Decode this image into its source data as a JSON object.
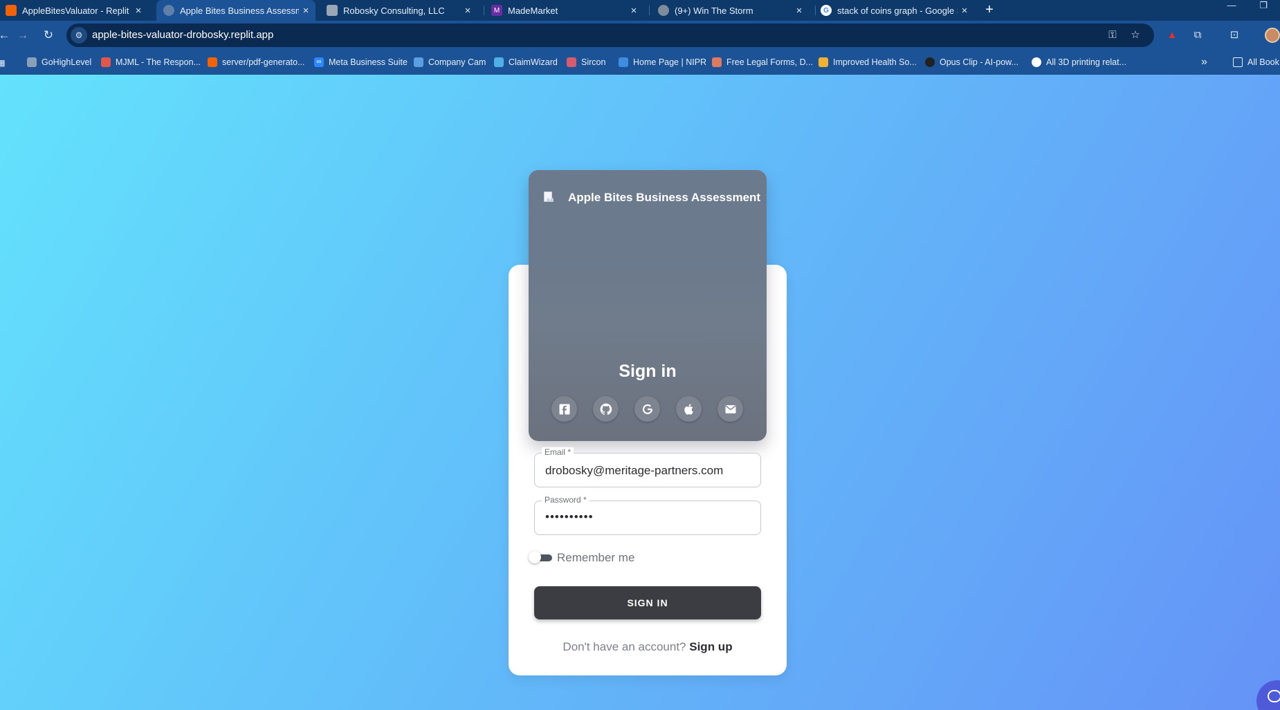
{
  "tabs": [
    {
      "title": "AppleBitesValuator - Replit",
      "icon": "replit-icon",
      "color": "#f26207"
    },
    {
      "title": "Apple Bites Business Assessmen",
      "icon": "globe-icon",
      "color": "#8aa4c4"
    },
    {
      "title": "Robosky Consulting, LLC",
      "icon": "company-icon",
      "color": "#9aa7b7"
    },
    {
      "title": "MadeMarket",
      "icon": "mademarket-icon",
      "color": "#6a2ca3"
    },
    {
      "title": "(9+) Win The Storm",
      "icon": "storm-icon",
      "color": "#7f8c9c"
    },
    {
      "title": "stack of coins graph - Google S",
      "icon": "google-icon",
      "color": "#ffffff"
    }
  ],
  "window": {
    "minimize": "—",
    "maximize": "❐"
  },
  "address_bar": {
    "url": "apple-bites-valuator-drobosky.replit.app"
  },
  "bookmarks": [
    {
      "label": "GoHighLevel",
      "icon": "gohighlevel-icon",
      "color": "#8aa0b8"
    },
    {
      "label": "MJML - The Respon...",
      "icon": "mjml-icon",
      "color": "#e2574c"
    },
    {
      "label": "server/pdf-generato...",
      "icon": "replit-icon",
      "color": "#f26207"
    },
    {
      "label": "Meta Business Suite",
      "icon": "meta-icon",
      "color": "#2d88ff"
    },
    {
      "label": "Company Cam",
      "icon": "companycam-icon",
      "color": "#5aa0e0"
    },
    {
      "label": "ClaimWizard",
      "icon": "claimwizard-icon",
      "color": "#4fb0e8"
    },
    {
      "label": "Sircon",
      "icon": "sircon-icon",
      "color": "#d95a6a"
    },
    {
      "label": "Home Page | NIPR",
      "icon": "nipr-icon",
      "color": "#3e8de0"
    },
    {
      "label": "Free Legal Forms, D...",
      "icon": "legalforms-icon",
      "color": "#e07a5f"
    },
    {
      "label": "Improved Health So...",
      "icon": "shield-heart-icon",
      "color": "#f2b12e"
    },
    {
      "label": "Opus Clip - AI-pow...",
      "icon": "opusclip-icon",
      "color": "#222222"
    },
    {
      "label": "All 3D printing relat...",
      "icon": "globe-icon",
      "color": "#ffffff"
    }
  ],
  "bookmarks_overflow": "»",
  "all_bookmarks": "All Book",
  "header_card": {
    "app_title": "Apple Bites Business Assessment",
    "heading": "Sign in",
    "social_icons": [
      "facebook-icon",
      "github-icon",
      "google-icon",
      "apple-icon",
      "email-icon"
    ]
  },
  "form": {
    "email_label": "Email *",
    "email_value": "drobosky@meritage-partners.com",
    "password_label": "Password *",
    "password_value": "••••••••••",
    "remember_label": "Remember me",
    "remember_checked": false,
    "submit_label": "SIGN IN",
    "signup_prompt": "Don't have an account?",
    "signup_link": "Sign up"
  }
}
